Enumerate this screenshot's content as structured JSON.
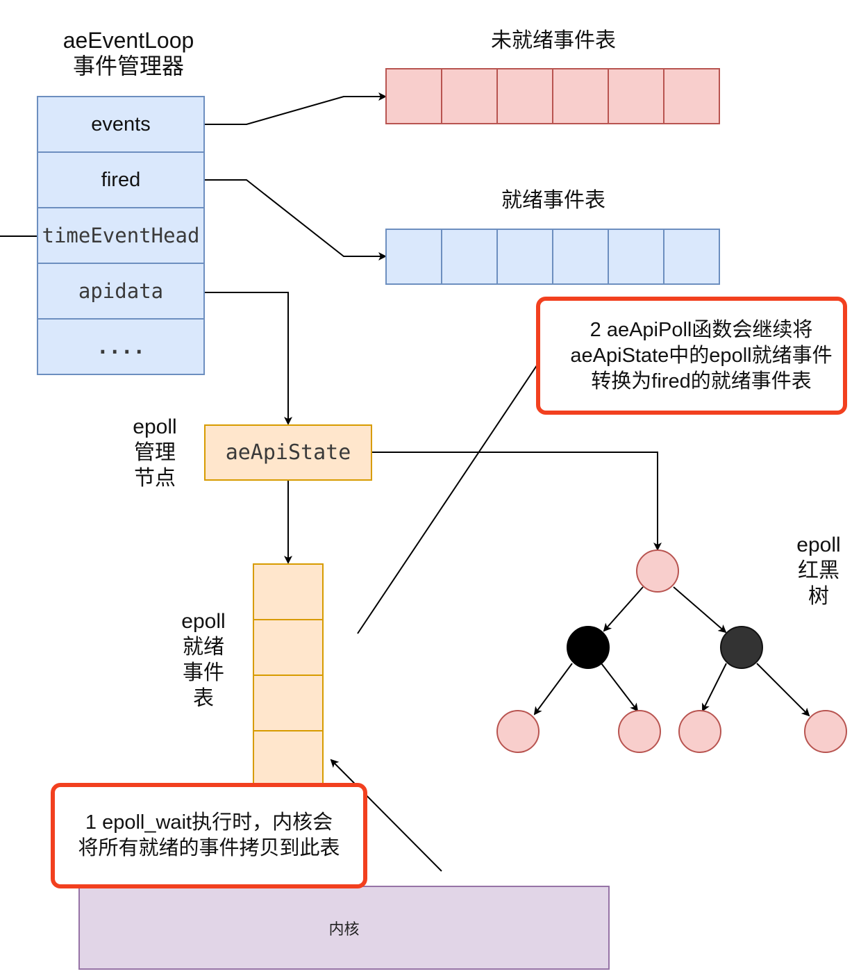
{
  "event_loop": {
    "title_line1": "aeEventLoop",
    "title_line2": "事件管理器",
    "fields": [
      "events",
      "fired",
      "timeEventHead",
      "apidata",
      "...."
    ]
  },
  "pending_table": {
    "title": "未就绪事件表",
    "slots": 6
  },
  "ready_table": {
    "title": "就绪事件表",
    "slots": 6
  },
  "api_state": {
    "label_line1": "epoll",
    "label_line2": "管理",
    "label_line3": "节点",
    "name": "aeApiState"
  },
  "epoll_ready_list": {
    "label_line1": "epoll",
    "label_line2": "就绪",
    "label_line3": "事件",
    "label_line4": "表",
    "slots": 4
  },
  "rb_tree": {
    "label_line1": "epoll",
    "label_line2": "红黑",
    "label_line3": "树",
    "node_colors": {
      "red_fill": "#f8cecc",
      "red_stroke": "#b85450",
      "black_fill": "#000000",
      "dark_fill": "#333333"
    }
  },
  "notes": {
    "step1": "1 epoll_wait执行时，内核会将所有就绪的事件拷贝到此表",
    "step2": "2 aeApiPoll函数会继续将aeApiState中的epoll就绪事件转换为fired的就绪事件表"
  },
  "kernel": {
    "label": "内核"
  },
  "colors": {
    "highlight": "#f2401f"
  }
}
